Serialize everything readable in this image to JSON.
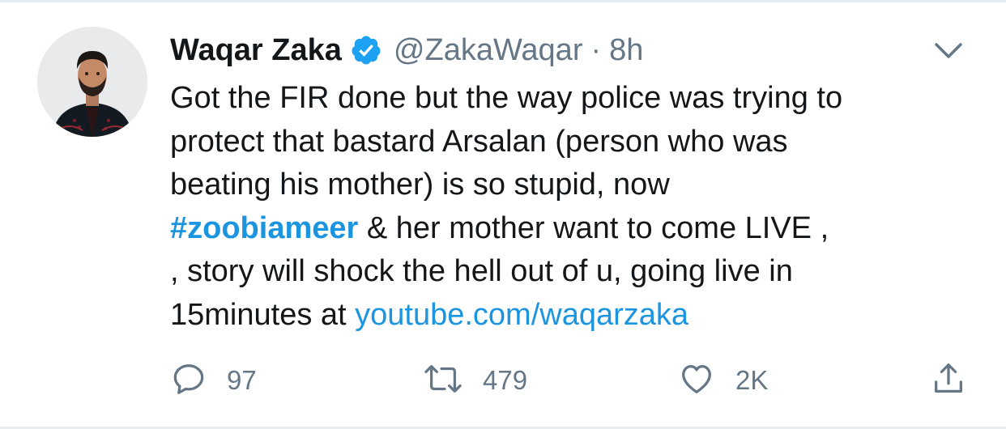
{
  "tweet": {
    "author": {
      "name": "Waqar Zaka",
      "handle": "@ZakaWaqar",
      "verified": true
    },
    "separator": "·",
    "time": "8h",
    "text_lines": [
      "Got the FIR done but the way police was trying to",
      "protect that bastard Arsalan (person who was",
      "beating his mother) is so stupid, now"
    ],
    "hashtag": "#zoobiameer",
    "after_hashtag": " & her mother want to come LIVE ,",
    "line5": ", story will shock the hell out of u, going live in",
    "line6_prefix": "15minutes at ",
    "link": "youtube.com/waqarzaka",
    "actions": {
      "replies": "97",
      "retweets": "479",
      "likes": "2K"
    }
  },
  "colors": {
    "text": "#14171a",
    "secondary": "#657786",
    "link": "#1b95e0",
    "verified": "#1da1f2",
    "border": "#e6ecf0"
  },
  "icons": [
    "verified-badge-icon",
    "chevron-down-icon",
    "reply-icon",
    "retweet-icon",
    "like-icon",
    "share-icon"
  ]
}
